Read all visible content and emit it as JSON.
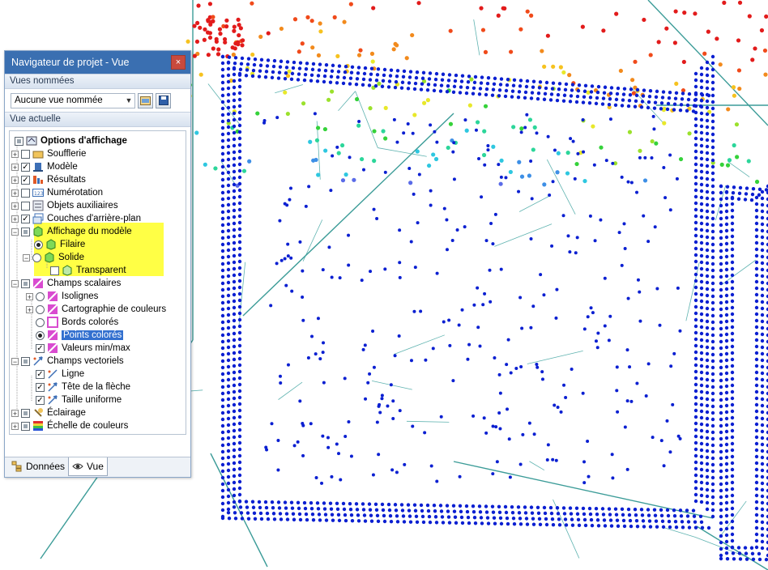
{
  "window": {
    "title": "Navigateur de projet - Vue",
    "close_glyph": "×"
  },
  "named_views": {
    "header": "Vues nommées",
    "selected": "Aucune vue nommée"
  },
  "current_view": {
    "header": "Vue actuelle"
  },
  "tree": {
    "root": "Options d'affichage",
    "items": [
      {
        "label": "Soufflerie"
      },
      {
        "label": "Modèle"
      },
      {
        "label": "Résultats"
      },
      {
        "label": "Numérotation"
      },
      {
        "label": "Objets auxiliaires"
      },
      {
        "label": "Couches d'arrière-plan"
      },
      {
        "label": "Affichage du modèle"
      },
      {
        "label": "Filaire"
      },
      {
        "label": "Solide"
      },
      {
        "label": "Transparent"
      },
      {
        "label": "Champs scalaires"
      },
      {
        "label": "Isolignes"
      },
      {
        "label": "Cartographie de couleurs"
      },
      {
        "label": "Bords colorés"
      },
      {
        "label": "Points colorés"
      },
      {
        "label": "Valeurs min/max"
      },
      {
        "label": "Champs vectoriels"
      },
      {
        "label": "Ligne"
      },
      {
        "label": "Tête de la flèche"
      },
      {
        "label": "Taille uniforme"
      },
      {
        "label": "Éclairage"
      },
      {
        "label": "Échelle de couleurs"
      }
    ]
  },
  "tabs": {
    "data": "Données",
    "view": "Vue"
  },
  "colors": {
    "accent": "#3a6fb1",
    "highlight": "#ffff45",
    "mesh": "#5fb3b0",
    "points": "#0a1fd1"
  }
}
